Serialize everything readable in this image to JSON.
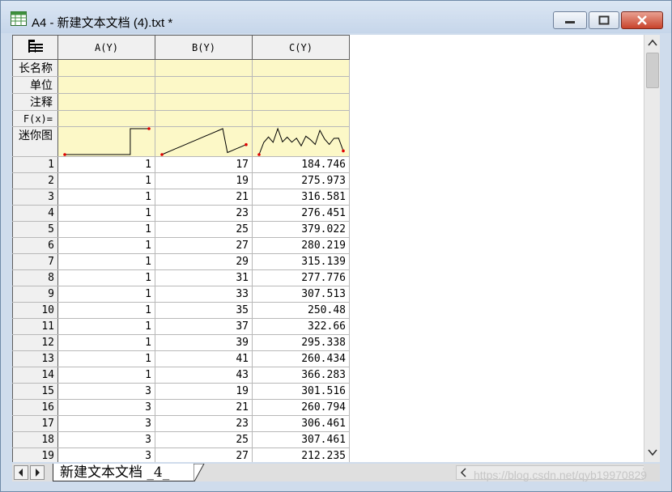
{
  "window": {
    "title": "A4 - 新建文本文档 (4).txt *"
  },
  "columns": [
    {
      "id": "A",
      "header": "A(Y)"
    },
    {
      "id": "B",
      "header": "B(Y)"
    },
    {
      "id": "C",
      "header": "C(Y)"
    }
  ],
  "meta_rows": {
    "long_name": "长名称",
    "units": "单位",
    "comments": "注释",
    "formula": "F(x)=",
    "sparklines": "迷你图"
  },
  "rows": [
    {
      "n": "1",
      "a": "1",
      "b": "17",
      "c": "184.746"
    },
    {
      "n": "2",
      "a": "1",
      "b": "19",
      "c": "275.973"
    },
    {
      "n": "3",
      "a": "1",
      "b": "21",
      "c": "316.581"
    },
    {
      "n": "4",
      "a": "1",
      "b": "23",
      "c": "276.451"
    },
    {
      "n": "5",
      "a": "1",
      "b": "25",
      "c": "379.022"
    },
    {
      "n": "6",
      "a": "1",
      "b": "27",
      "c": "280.219"
    },
    {
      "n": "7",
      "a": "1",
      "b": "29",
      "c": "315.139"
    },
    {
      "n": "8",
      "a": "1",
      "b": "31",
      "c": "277.776"
    },
    {
      "n": "9",
      "a": "1",
      "b": "33",
      "c": "307.513"
    },
    {
      "n": "10",
      "a": "1",
      "b": "35",
      "c": "250.48"
    },
    {
      "n": "11",
      "a": "1",
      "b": "37",
      "c": "322.66"
    },
    {
      "n": "12",
      "a": "1",
      "b": "39",
      "c": "295.338"
    },
    {
      "n": "13",
      "a": "1",
      "b": "41",
      "c": "260.434"
    },
    {
      "n": "14",
      "a": "1",
      "b": "43",
      "c": "366.283"
    },
    {
      "n": "15",
      "a": "3",
      "b": "19",
      "c": "301.516"
    },
    {
      "n": "16",
      "a": "3",
      "b": "21",
      "c": "260.794"
    },
    {
      "n": "17",
      "a": "3",
      "b": "23",
      "c": "306.461"
    },
    {
      "n": "18",
      "a": "3",
      "b": "25",
      "c": "307.461"
    },
    {
      "n": "19",
      "a": "3",
      "b": "27",
      "c": "212.235"
    }
  ],
  "sheet_tab": {
    "label": "新建文本文档 _4_"
  },
  "watermark": "https://blog.csdn.net/qyb19970829",
  "colors": {
    "meta_bg": "#fcf8c7",
    "sparkline": "#000000",
    "sparkline_endpoint": "#e00000",
    "close_button": "#c8432b"
  },
  "icons": [
    "worksheet-icon",
    "minimize-icon",
    "maximize-icon",
    "close-icon",
    "scroll-up-icon",
    "scroll-down-icon",
    "tab-prev-icon",
    "tab-next-icon",
    "scroll-left-icon",
    "scroll-right-icon"
  ]
}
